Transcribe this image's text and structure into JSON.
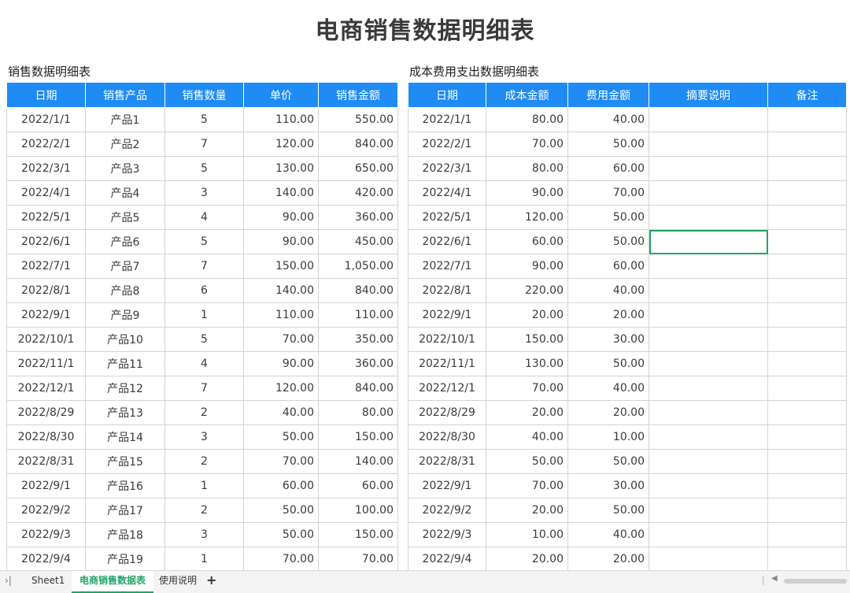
{
  "title": "电商销售数据明细表",
  "left_table": {
    "caption": "销售数据明细表",
    "headers": [
      "日期",
      "销售产品",
      "销售数量",
      "单价",
      "销售金额"
    ],
    "rows": [
      [
        "2022/1/1",
        "产品1",
        "5",
        "110.00",
        "550.00"
      ],
      [
        "2022/2/1",
        "产品2",
        "7",
        "120.00",
        "840.00"
      ],
      [
        "2022/3/1",
        "产品3",
        "5",
        "130.00",
        "650.00"
      ],
      [
        "2022/4/1",
        "产品4",
        "3",
        "140.00",
        "420.00"
      ],
      [
        "2022/5/1",
        "产品5",
        "4",
        "90.00",
        "360.00"
      ],
      [
        "2022/6/1",
        "产品6",
        "5",
        "90.00",
        "450.00"
      ],
      [
        "2022/7/1",
        "产品7",
        "7",
        "150.00",
        "1,050.00"
      ],
      [
        "2022/8/1",
        "产品8",
        "6",
        "140.00",
        "840.00"
      ],
      [
        "2022/9/1",
        "产品9",
        "1",
        "110.00",
        "110.00"
      ],
      [
        "2022/10/1",
        "产品10",
        "5",
        "70.00",
        "350.00"
      ],
      [
        "2022/11/1",
        "产品11",
        "4",
        "90.00",
        "360.00"
      ],
      [
        "2022/12/1",
        "产品12",
        "7",
        "120.00",
        "840.00"
      ],
      [
        "2022/8/29",
        "产品13",
        "2",
        "40.00",
        "80.00"
      ],
      [
        "2022/8/30",
        "产品14",
        "3",
        "50.00",
        "150.00"
      ],
      [
        "2022/8/31",
        "产品15",
        "2",
        "70.00",
        "140.00"
      ],
      [
        "2022/9/1",
        "产品16",
        "1",
        "60.00",
        "60.00"
      ],
      [
        "2022/9/2",
        "产品17",
        "2",
        "50.00",
        "100.00"
      ],
      [
        "2022/9/3",
        "产品18",
        "3",
        "50.00",
        "150.00"
      ],
      [
        "2022/9/4",
        "产品19",
        "1",
        "70.00",
        "70.00"
      ]
    ]
  },
  "right_table": {
    "caption": "成本费用支出数据明细表",
    "headers": [
      "日期",
      "成本金额",
      "费用金额",
      "摘要说明",
      "备注"
    ],
    "rows": [
      [
        "2022/1/1",
        "80.00",
        "40.00",
        "",
        ""
      ],
      [
        "2022/2/1",
        "70.00",
        "50.00",
        "",
        ""
      ],
      [
        "2022/3/1",
        "80.00",
        "60.00",
        "",
        ""
      ],
      [
        "2022/4/1",
        "90.00",
        "70.00",
        "",
        ""
      ],
      [
        "2022/5/1",
        "120.00",
        "50.00",
        "",
        ""
      ],
      [
        "2022/6/1",
        "60.00",
        "50.00",
        "",
        ""
      ],
      [
        "2022/7/1",
        "90.00",
        "60.00",
        "",
        ""
      ],
      [
        "2022/8/1",
        "220.00",
        "40.00",
        "",
        ""
      ],
      [
        "2022/9/1",
        "20.00",
        "20.00",
        "",
        ""
      ],
      [
        "2022/10/1",
        "150.00",
        "30.00",
        "",
        ""
      ],
      [
        "2022/11/1",
        "130.00",
        "50.00",
        "",
        ""
      ],
      [
        "2022/12/1",
        "70.00",
        "40.00",
        "",
        ""
      ],
      [
        "2022/8/29",
        "20.00",
        "20.00",
        "",
        ""
      ],
      [
        "2022/8/30",
        "40.00",
        "10.00",
        "",
        ""
      ],
      [
        "2022/8/31",
        "50.00",
        "50.00",
        "",
        ""
      ],
      [
        "2022/9/1",
        "70.00",
        "30.00",
        "",
        ""
      ],
      [
        "2022/9/2",
        "20.00",
        "50.00",
        "",
        ""
      ],
      [
        "2022/9/3",
        "10.00",
        "40.00",
        "",
        ""
      ],
      [
        "2022/9/4",
        "20.00",
        "20.00",
        "",
        ""
      ]
    ],
    "selected_cell": {
      "row": 6,
      "column": 4
    }
  },
  "sheet_tabs": [
    {
      "label": "Sheet1",
      "active": false
    },
    {
      "label": "电商销售数据表",
      "active": true
    },
    {
      "label": "使用说明",
      "active": false
    }
  ],
  "tab_nav_glyph": "›|",
  "add_tab_glyph": "+",
  "colors": {
    "header_bg": "#1f8bf4",
    "header_text": "#ffffff",
    "grid_line": "#d4d4d4",
    "selection": "#21a366",
    "active_tab": "#21a366"
  },
  "icons": {
    "add_tab": "plus-icon",
    "tab_nav": "last-sheet-icon",
    "scroll_left": "caret-left-icon"
  }
}
